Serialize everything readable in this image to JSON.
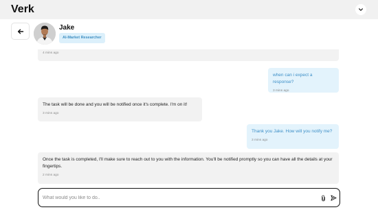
{
  "app": {
    "title": "Verk"
  },
  "icons": {
    "menu": "chevron-down-icon",
    "back": "arrow-left-icon",
    "attach": "paperclip-icon",
    "send": "send-icon"
  },
  "agent": {
    "name": "Jake",
    "role": "AI-Market Researcher"
  },
  "messages": [
    {
      "sender": "agent",
      "text": "",
      "time": "4 mins ago"
    },
    {
      "sender": "user",
      "text": "when can i expect a response?",
      "time": "3 mins ago"
    },
    {
      "sender": "agent",
      "text": "The task will be done and you will be notified once it's complete. I'm on it!",
      "time": "3 mins ago"
    },
    {
      "sender": "user",
      "text": "Thank you Jake. How will you notify me?",
      "time": "3 mins ago"
    },
    {
      "sender": "agent",
      "text": "Once the task is completed, I'll make sure to reach out to you with the information. You'll be notified promptly so you can have all the details at your fingertips.",
      "time": "2 mins ago"
    }
  ],
  "composer": {
    "placeholder": "What would you like to do..",
    "value": ""
  },
  "colors": {
    "topbar": "#f1f1f1",
    "user_bubble": "#e3f3fc",
    "user_text": "#3d8fc7",
    "agent_bubble": "#f2f2f2",
    "badge_bg": "#dcf0fb",
    "badge_text": "#3f8fc2"
  }
}
